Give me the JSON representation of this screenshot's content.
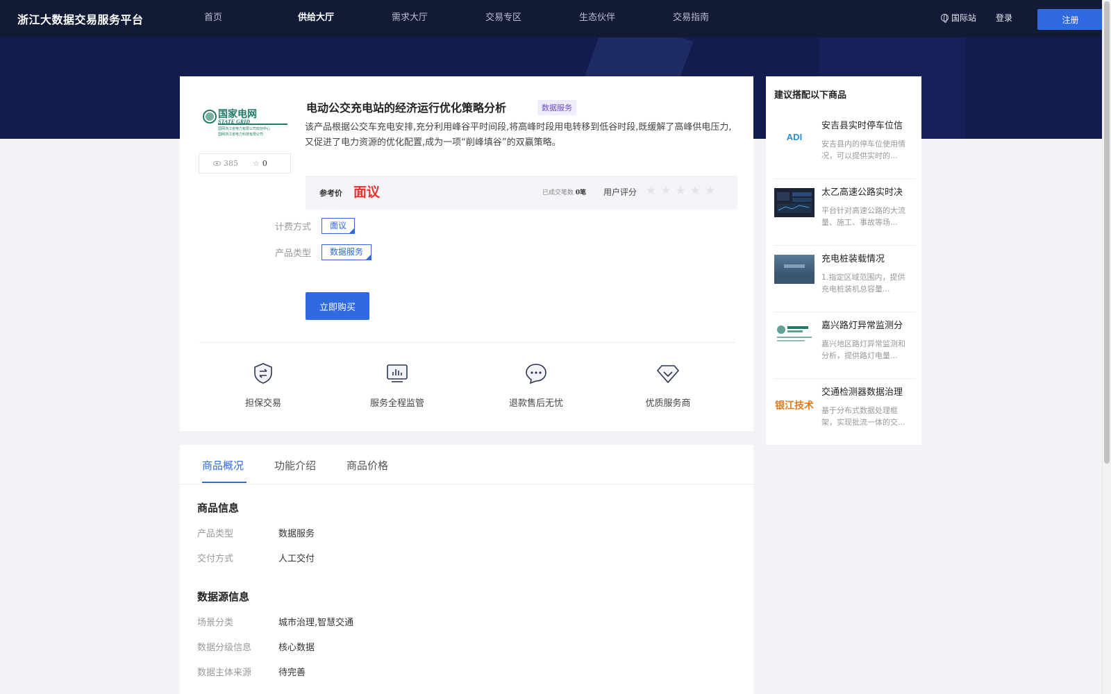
{
  "header": {
    "brand": "浙江大数据交易服务平台",
    "nav": [
      "首页",
      "供给大厅",
      "需求大厅",
      "交易专区",
      "生态伙伴",
      "交易指南"
    ],
    "active_nav": "供给大厅",
    "intl": "国际站",
    "login": "登录",
    "register": "注册"
  },
  "product": {
    "logo": {
      "name": "国家电网",
      "en": "STATE GRID",
      "sub1": "国网浙江省电力有限公司双创中心",
      "sub2": "国网浙江省电力科技有限公司"
    },
    "views": "385",
    "favorites": "0",
    "title": "电动公交充电站的经济运行优化策略分析",
    "tag": "数据服务",
    "description": "该产品根据公交车充电安排,充分利用峰谷平时间段,将高峰时段用电转移到低谷时段,既缓解了高峰供电压力,又促进了电力资源的优化配置,成为一项“削峰填谷”的双赢策略。",
    "price_label": "参考价",
    "price": "面议",
    "deals_label": "已成交笔数",
    "deals": "0笔",
    "rating_label": "用户评分",
    "rating": 0,
    "billing_label": "计费方式",
    "billing": "面议",
    "type_label": "产品类型",
    "type": "数据服务",
    "buy": "立即购买"
  },
  "features": [
    "担保交易",
    "服务全程监管",
    "退款售后无忧",
    "优质服务商"
  ],
  "tabs": [
    "商品概况",
    "功能介绍",
    "商品价格"
  ],
  "active_tab": "商品概况",
  "details": {
    "section1_title": "商品信息",
    "section1": [
      {
        "label": "产品类型",
        "value": "数据服务"
      },
      {
        "label": "交付方式",
        "value": "人工交付"
      }
    ],
    "section2_title": "数据源信息",
    "section2": [
      {
        "label": "场景分类",
        "value": "城市治理,智慧交通"
      },
      {
        "label": "数据分级信息",
        "value": "核心数据"
      },
      {
        "label": "数据主体来源",
        "value": "待完善"
      }
    ]
  },
  "sidebar": {
    "title": "建议搭配以下商品",
    "items": [
      {
        "name": "安吉县实时停车位信",
        "desc": "安吉县内的停车位使用情况，可以提供实时的..."
      },
      {
        "name": "太乙高速公路实时决",
        "desc": "平台针对高速公路的大流量、施工、事故等场..."
      },
      {
        "name": "充电桩装载情况",
        "desc": "1.指定区域范围内，提供充电桩装机总容量..."
      },
      {
        "name": "嘉兴路灯异常监测分",
        "desc": "嘉兴地区路灯异常监测和分析，提供路灯电量..."
      },
      {
        "name": "交通检测器数据治理",
        "desc": "基于分布式数据处理框架，实现批流一体的交..."
      }
    ],
    "thumb_texts": {
      "adi": "ADI",
      "yinjiang": "银江技术"
    }
  },
  "colors": {
    "accent": "#2f6ae0",
    "header_bg": "#121a35",
    "price_red": "#e8312f"
  }
}
